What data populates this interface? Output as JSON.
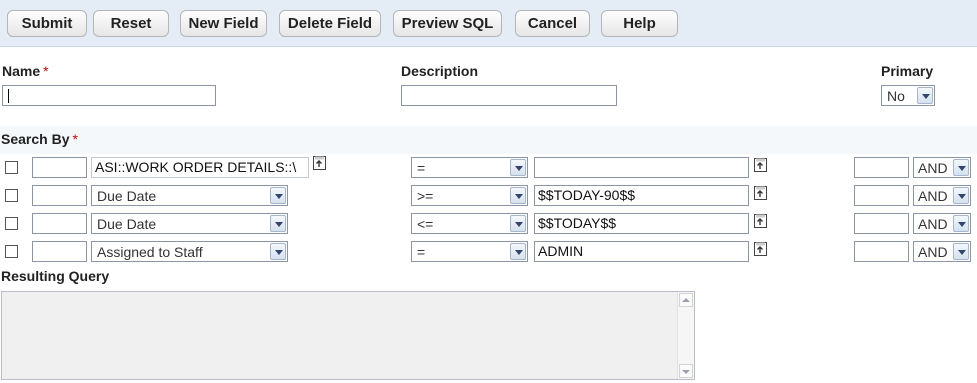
{
  "toolbar": {
    "submit": "Submit",
    "reset": "Reset",
    "new_field": "New Field",
    "delete_field": "Delete Field",
    "preview_sql": "Preview SQL",
    "cancel": "Cancel",
    "help": "Help"
  },
  "form": {
    "name_label": "Name",
    "name_value": "",
    "required_mark": "*",
    "description_label": "Description",
    "description_value": "",
    "primary_label": "Primary",
    "primary_value": "No"
  },
  "search_by": {
    "label": "Search By",
    "required_mark": "*",
    "rows": [
      {
        "checked": false,
        "order": "",
        "field": "ASI::WORK ORDER DETAILS::\\",
        "field_type": "text",
        "operator": "=",
        "value": "",
        "paren": "",
        "conjunction": "AND"
      },
      {
        "checked": false,
        "order": "",
        "field": "Due Date",
        "field_type": "select",
        "operator": ">=",
        "value": "$$TODAY-90$$",
        "paren": "",
        "conjunction": "AND"
      },
      {
        "checked": false,
        "order": "",
        "field": "Due Date",
        "field_type": "select",
        "operator": "<=",
        "value": "$$TODAY$$",
        "paren": "",
        "conjunction": "AND"
      },
      {
        "checked": false,
        "order": "",
        "field": "Assigned to Staff",
        "field_type": "select",
        "operator": "=",
        "value": "ADMIN",
        "paren": "",
        "conjunction": "AND"
      }
    ]
  },
  "resulting_query": {
    "label": "Resulting Query",
    "value": ""
  },
  "colors": {
    "toolbar_bg": "#e4ecf6",
    "required": "#cc0000",
    "field_border": "#8a96a5"
  }
}
